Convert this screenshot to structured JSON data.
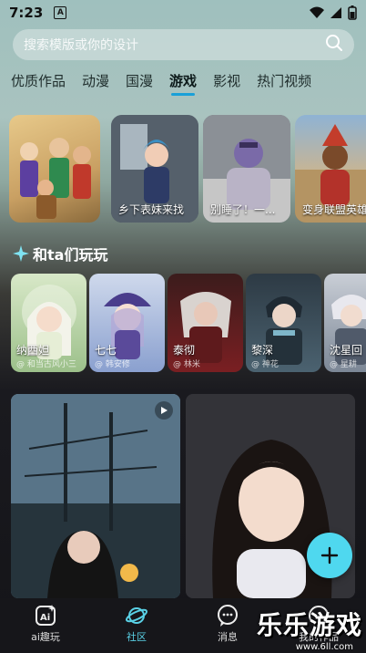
{
  "status": {
    "time": "7:23",
    "notif_glyph": "A"
  },
  "search": {
    "placeholder": "搜索模版或你的设计"
  },
  "tabs": [
    {
      "label": "优质作品"
    },
    {
      "label": "动漫"
    },
    {
      "label": "国漫"
    },
    {
      "label": "游戏"
    },
    {
      "label": "影视"
    },
    {
      "label": "热门视频"
    }
  ],
  "banners": [
    {
      "caption": ""
    },
    {
      "caption": "乡下表妹来找"
    },
    {
      "caption": "别睡了！一..."
    },
    {
      "caption": "变身联盟英雄"
    }
  ],
  "section": {
    "title": "和ta们玩玩"
  },
  "characters": [
    {
      "name": "纳西妲",
      "author": "@ 和当古风小三"
    },
    {
      "name": "七七",
      "author": "@ 韩安修"
    },
    {
      "name": "泰彻",
      "author": "@ 林米"
    },
    {
      "name": "黎深",
      "author": "@ 神花"
    },
    {
      "name": "沈星回",
      "author": "@ 星耕"
    }
  ],
  "nav": [
    {
      "label": "ai趣玩",
      "icon": "ai-icon"
    },
    {
      "label": "社区",
      "icon": "planet-icon"
    },
    {
      "label": "消息",
      "icon": "message-icon"
    },
    {
      "label": "我的作品",
      "icon": "works-icon"
    }
  ],
  "watermark": {
    "title": "乐乐游戏",
    "url": "www.6ll.com"
  }
}
